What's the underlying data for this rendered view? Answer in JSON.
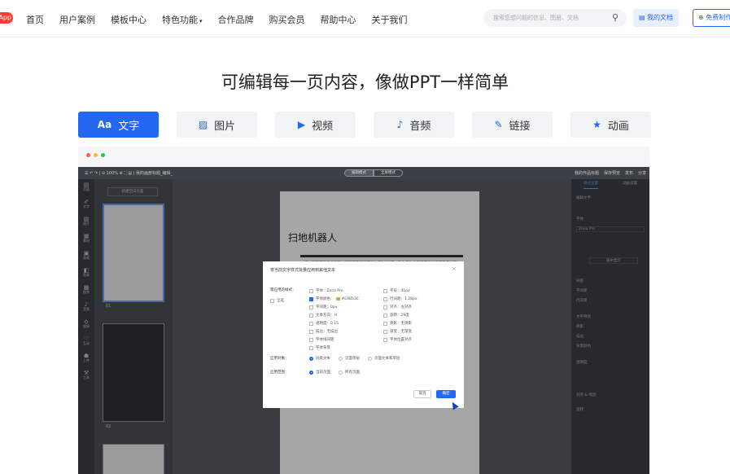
{
  "nav": {
    "logo": "App",
    "items": [
      "首页",
      "用户案例",
      "模板中心",
      "特色功能",
      "合作品牌",
      "购买会员",
      "帮助中心",
      "关于我们"
    ],
    "dropdown_caret": "▾",
    "search_placeholder": "搜索您想问题的信息、图册、文档",
    "search_icon": "search-icon",
    "my_docs": "我的文档",
    "free_make": "免费制作"
  },
  "headline": "可编辑每一页内容，像做PPT一样简单",
  "tabs": [
    {
      "label": "文字",
      "icon": "Aa",
      "active": true
    },
    {
      "label": "图片",
      "icon": "▨"
    },
    {
      "label": "视频",
      "icon": "▶"
    },
    {
      "label": "音频",
      "icon": "♪"
    },
    {
      "label": "链接",
      "icon": "✎"
    },
    {
      "label": "动画",
      "icon": "★"
    }
  ],
  "colors": {
    "accent": "#2468f2",
    "logo": "#ff3b30"
  },
  "editor": {
    "toolbar_left": "☰  ↶ ↷ | ⊖ 100% ⊕ ⛶ ▤ | 我的画册标题_编辑_",
    "mode_tabs": [
      "编辑模式",
      "全屏模式"
    ],
    "toolbar_right": [
      "我的作品标题",
      "保存预览",
      "发布",
      "分享"
    ],
    "left_icons": [
      {
        "glyph": "▤",
        "label": "页面"
      },
      {
        "glyph": "✐",
        "label": "文字"
      },
      {
        "glyph": "▨",
        "label": "图片"
      },
      {
        "glyph": "▦",
        "label": "素材"
      },
      {
        "glyph": "▣",
        "label": "表格"
      },
      {
        "glyph": "◧",
        "label": "图表"
      },
      {
        "glyph": "▩",
        "label": "视频"
      },
      {
        "glyph": "♪",
        "label": "音频"
      },
      {
        "glyph": "⬦",
        "label": "链接"
      },
      {
        "glyph": "♡",
        "label": "互动"
      },
      {
        "glyph": "☗",
        "label": "上传"
      },
      {
        "glyph": "⚒",
        "label": "工具"
      }
    ],
    "new_page": "新建空白页面",
    "thumb_nums": [
      "01",
      "02"
    ],
    "slide_title": "扫地机器人",
    "slide_text": "广州万和信息技术有限公司旗下的云展网创立于2008年，致力于为上传者提供优质的电子画册在线制作服务，让您轻松在线将PDF文件转换成可翻页的电子书。",
    "right_tabs": [
      "样式设置",
      "动画设置"
    ],
    "right_rows": [
      "编辑文字",
      "字体",
      "Zona Pro",
      "居中显示",
      "间距",
      "字间距",
      "行间距",
      "文字特效",
      "阴影",
      "描边",
      "背景颜色",
      "透明度",
      "旋转",
      "对齐 & 缩放",
      "旋转"
    ]
  },
  "modal": {
    "title": "将当前文字样式批量应用到其他文本",
    "close": "×",
    "styles_label": "需应用的样式：",
    "select_all": "全选",
    "col1": [
      {
        "text": "字体：Zona Pro",
        "checked": false
      },
      {
        "text": "字体颜色：",
        "checked": true,
        "color": "#e6a23c",
        "value": "#E4B53C"
      },
      {
        "text": "字间距：0px",
        "checked": false
      },
      {
        "text": "文本方向：H",
        "checked": false
      },
      {
        "text": "透明度：0.15",
        "checked": false
      },
      {
        "text": "描边：无描边",
        "checked": false
      },
      {
        "text": "字体线间距",
        "checked": false
      },
      {
        "text": "字体背景",
        "checked": false
      }
    ],
    "col2": [
      {
        "text": "字号：41px",
        "checked": false
      },
      {
        "text": "行间距：1.28px",
        "checked": false
      },
      {
        "text": "对齐：左对齐",
        "checked": false
      },
      {
        "text": "旋转：29度",
        "checked": false
      },
      {
        "text": "阴影：无阴影",
        "checked": false
      },
      {
        "text": "渐变：无渐变",
        "checked": false
      },
      {
        "text": "字体位置对齐",
        "checked": false
      }
    ],
    "target_label": "应用对象：",
    "targets": [
      {
        "text": "同类文本",
        "on": true
      },
      {
        "text": "页面单层",
        "on": false
      },
      {
        "text": "页面文本和单层",
        "on": false
      }
    ],
    "range_label": "应用范围：",
    "ranges": [
      {
        "text": "当前页面",
        "on": true
      },
      {
        "text": "所有页面",
        "on": false
      }
    ],
    "cancel": "取消",
    "ok": "确定"
  }
}
